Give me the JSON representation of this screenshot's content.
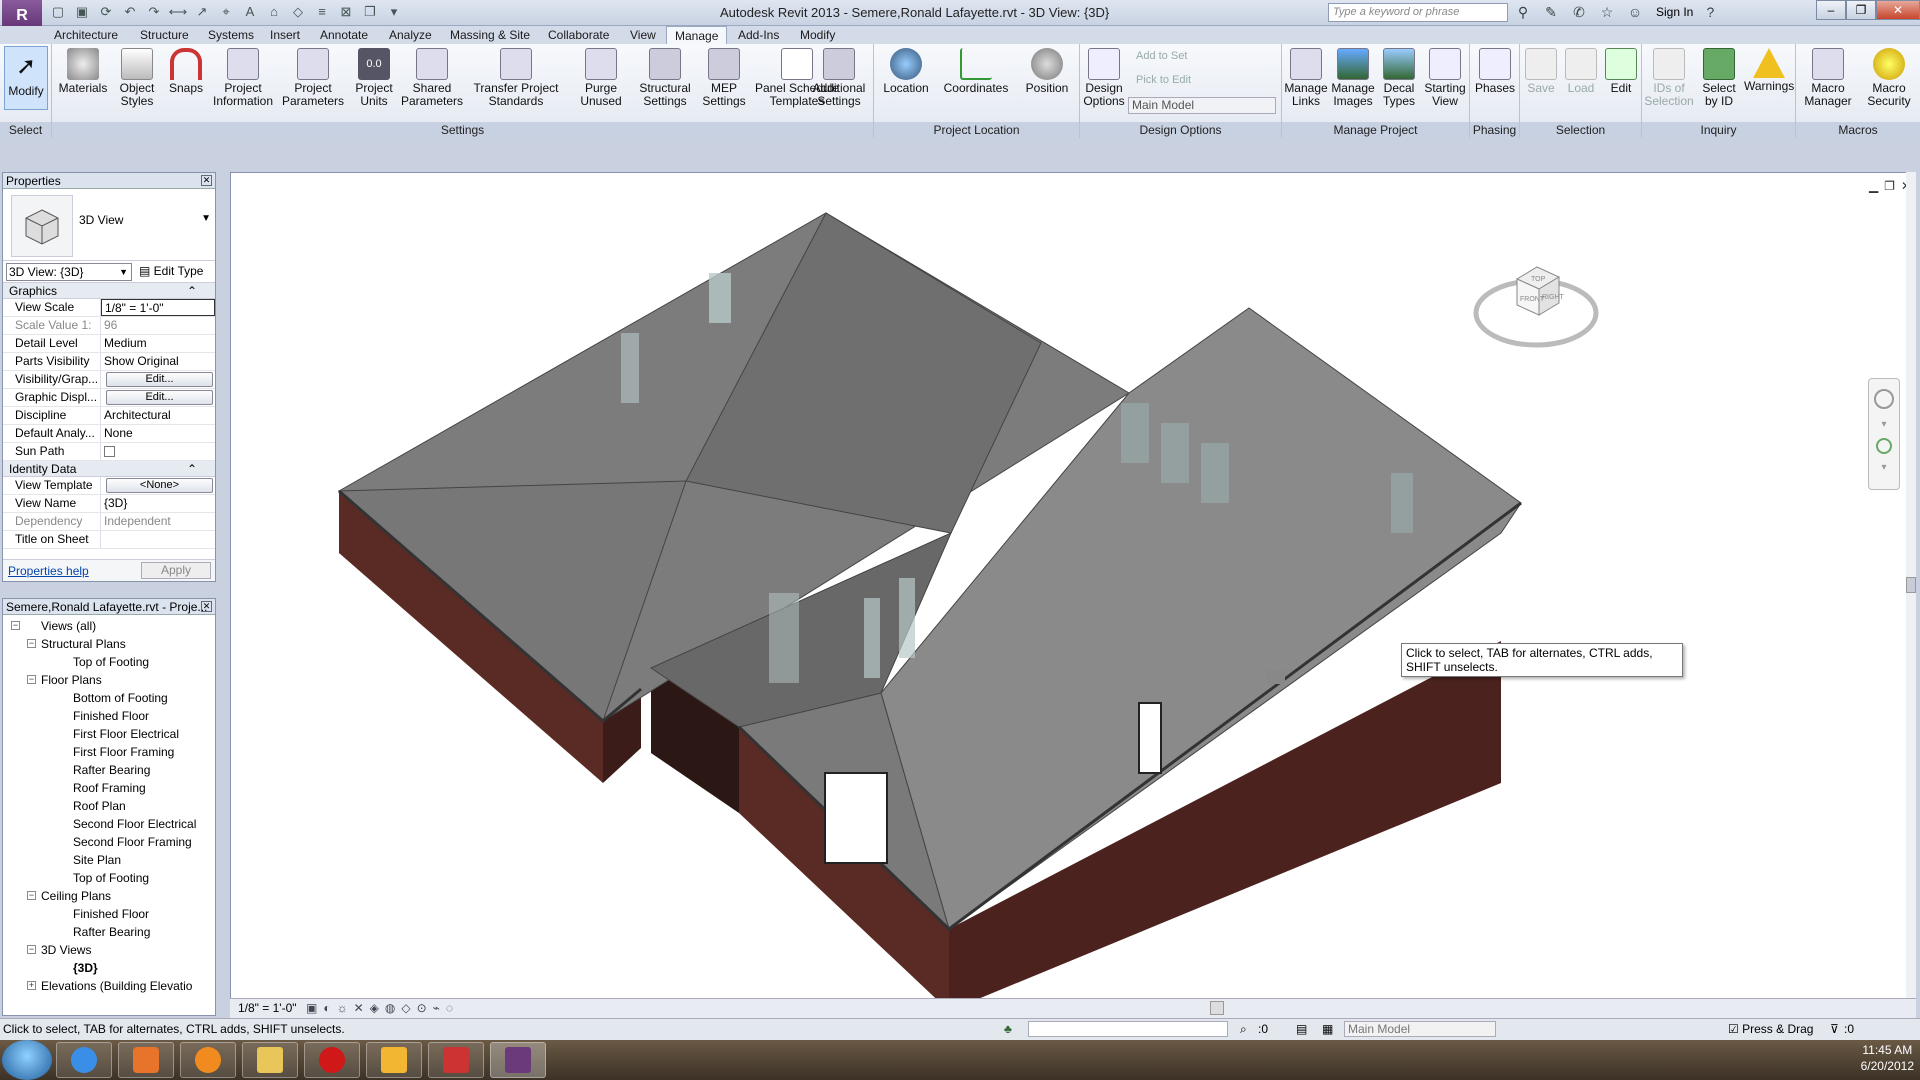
{
  "app": {
    "logo": "R",
    "title": "Autodesk Revit 2013 -      Semere,Ronald Lafayette.rvt - 3D View: {3D}"
  },
  "search": {
    "placeholder": "Type a keyword or phrase"
  },
  "signin": "Sign In",
  "tabs": [
    "Architecture",
    "Structure",
    "Systems",
    "Insert",
    "Annotate",
    "Analyze",
    "Massing & Site",
    "Collaborate",
    "View",
    "Manage",
    "Add-Ins",
    "Modify"
  ],
  "active_tab": "Manage",
  "ribbon": {
    "select": {
      "modify": "Modify",
      "label": "Select"
    },
    "settings": {
      "label": "Settings",
      "buttons": [
        "Materials",
        "Object Styles",
        "Snaps",
        "Project Information",
        "Project Parameters",
        "Project Units",
        "Shared Parameters",
        "Transfer Project Standards",
        "Purge Unused",
        "Structural Settings",
        "MEP Settings",
        "Panel Schedule Templates",
        "Additional Settings"
      ]
    },
    "location": {
      "label": "Project Location",
      "buttons": [
        "Location",
        "Coordinates",
        "Position"
      ]
    },
    "design": {
      "label": "Design Options",
      "button": "Design Options",
      "add": "Add to Set",
      "pick": "Pick to Edit",
      "model": "Main Model"
    },
    "manage": {
      "label": "Manage Project",
      "buttons": [
        "Manage Links",
        "Manage Images",
        "Decal Types",
        "Starting View"
      ]
    },
    "phasing": {
      "label": "Phasing",
      "button": "Phases"
    },
    "selection": {
      "label": "Selection",
      "buttons": [
        "Save",
        "Load",
        "Edit"
      ]
    },
    "inquiry": {
      "label": "Inquiry",
      "buttons": [
        "IDs of Selection",
        "Select by ID",
        "Warnings"
      ]
    },
    "macros": {
      "label": "Macros",
      "buttons": [
        "Macro Manager",
        "Macro Security"
      ]
    }
  },
  "properties": {
    "title": "Properties",
    "type": "3D View",
    "view_select": "3D View: {3D}",
    "edit_type": "Edit Type",
    "graphics_header": "Graphics",
    "graphics": [
      [
        "View Scale",
        "1/8\" = 1'-0\""
      ],
      [
        "Scale Value    1:",
        "96"
      ],
      [
        "Detail Level",
        "Medium"
      ],
      [
        "Parts Visibility",
        "Show Original"
      ],
      [
        "Visibility/Grap...",
        "Edit..."
      ],
      [
        "Graphic Displ...",
        "Edit..."
      ],
      [
        "Discipline",
        "Architectural"
      ],
      [
        "Default Analy...",
        "None"
      ],
      [
        "Sun Path",
        ""
      ]
    ],
    "identity_header": "Identity Data",
    "identity": [
      [
        "View Template",
        "<None>"
      ],
      [
        "View Name",
        "{3D}"
      ],
      [
        "Dependency",
        "Independent"
      ],
      [
        "Title on Sheet",
        ""
      ]
    ],
    "help": "Properties help",
    "apply": "Apply"
  },
  "browser": {
    "title": "Semere,Ronald Lafayette.rvt - Proje...",
    "items": [
      {
        "label": "Views (all)",
        "level": 0,
        "box": "−"
      },
      {
        "label": "Structural Plans",
        "level": 1,
        "box": "−"
      },
      {
        "label": "Top of Footing",
        "level": 2
      },
      {
        "label": "Floor Plans",
        "level": 1,
        "box": "−"
      },
      {
        "label": "Bottom of Footing",
        "level": 2
      },
      {
        "label": "Finished Floor",
        "level": 2
      },
      {
        "label": "First Floor Electrical",
        "level": 2
      },
      {
        "label": "First Floor Framing",
        "level": 2
      },
      {
        "label": "Rafter Bearing",
        "level": 2
      },
      {
        "label": "Roof Framing",
        "level": 2
      },
      {
        "label": "Roof Plan",
        "level": 2
      },
      {
        "label": "Second Floor Electrical",
        "level": 2
      },
      {
        "label": "Second Floor Framing",
        "level": 2
      },
      {
        "label": "Site Plan",
        "level": 2
      },
      {
        "label": "Top of Footing",
        "level": 2
      },
      {
        "label": "Ceiling Plans",
        "level": 1,
        "box": "−"
      },
      {
        "label": "Finished Floor",
        "level": 2
      },
      {
        "label": "Rafter Bearing",
        "level": 2
      },
      {
        "label": "3D Views",
        "level": 1,
        "box": "−"
      },
      {
        "label": "{3D}",
        "level": 2,
        "bold": true
      },
      {
        "label": "Elevations (Building Elevatio",
        "level": 1,
        "box": "+"
      }
    ]
  },
  "viewcube": {
    "top": "TOP",
    "front": "FRONT",
    "right": "RIGHT"
  },
  "tooltip": "Click to select, TAB for alternates, CTRL adds, SHIFT unselects.",
  "viewbar": {
    "scale": "1/8\" = 1'-0\""
  },
  "status": {
    "text": "Click to select, TAB for alternates, CTRL adds, SHIFT unselects.",
    "zero1": ":0",
    "model": "Main Model",
    "press_drag": "Press & Drag",
    "zero2": ":0"
  },
  "taskbar": {
    "time": "11:45 AM",
    "date": "6/20/2012"
  }
}
